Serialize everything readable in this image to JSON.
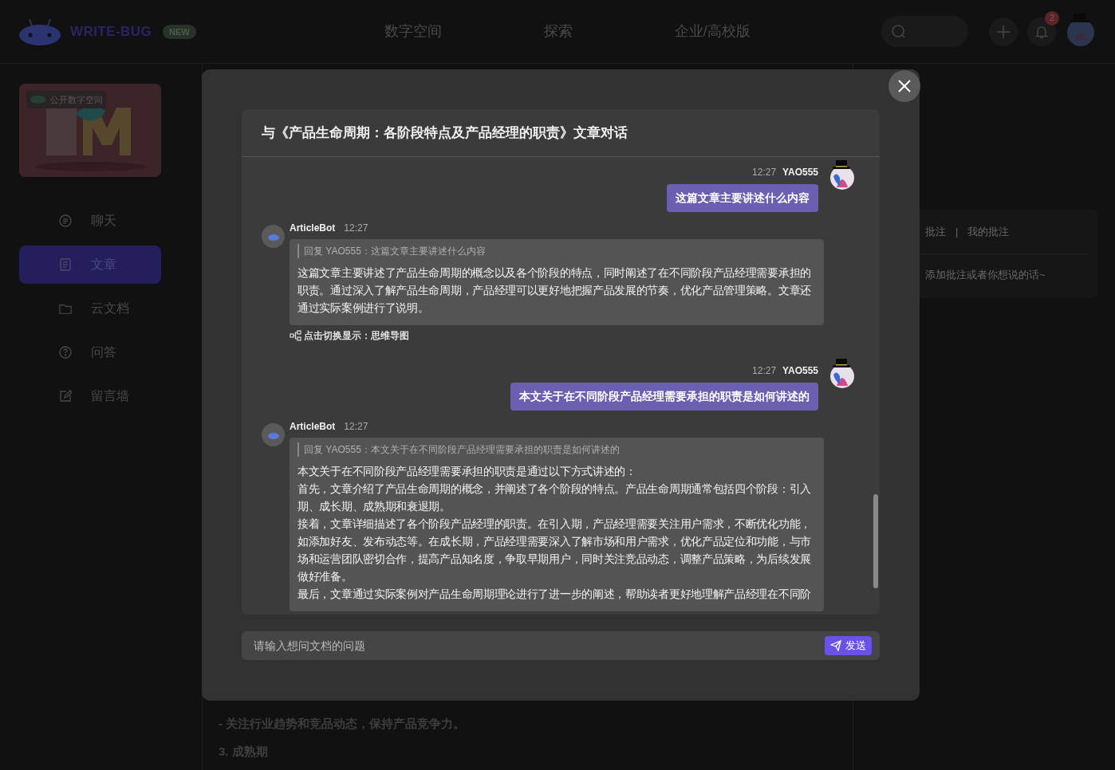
{
  "header": {
    "logo_text": "WRITE-BUG",
    "badge": "NEW",
    "nav": [
      {
        "label": "数字空间",
        "selected": false
      },
      {
        "label": "探索",
        "selected": false
      },
      {
        "label": "企业/高校版",
        "selected": false
      }
    ],
    "notification_count": "2"
  },
  "sidebar": {
    "card_label": "公开数字空间",
    "items": [
      {
        "label": "聊天",
        "selected": false
      },
      {
        "label": "文章",
        "selected": true
      },
      {
        "label": "云文档",
        "selected": false
      },
      {
        "label": "问答",
        "selected": false
      },
      {
        "label": "留言墙",
        "selected": false
      }
    ]
  },
  "article": {
    "lines": [
      "- 关注行业趋势和竞品动态，保持产品竞争力。",
      "3. 成熟期"
    ]
  },
  "annotations": {
    "separator": "|",
    "tabs": [
      {
        "label": "批注",
        "selected": false
      },
      {
        "label": "我的批注",
        "selected": false
      }
    ],
    "hint": "添加批注或者你想说的话~"
  },
  "dialog": {
    "title": "与《产品生命周期：各阶段特点及产品经理的职责》文章对话",
    "messages": [
      {
        "kind": "user",
        "time": "12:27",
        "author": "YAO555",
        "text": "这篇文章主要讲述什么内容"
      },
      {
        "kind": "bot",
        "author": "ArticleBot",
        "time": "12:27",
        "quote": "回复 YAO555：这篇文章主要讲述什么内容",
        "paragraphs": [
          "这篇文章主要讲述了产品生命周期的概念以及各个阶段的特点，同时阐述了在不同阶段产品经理需要承担的职责。通过深入了解产品生命周期，产品经理可以更好地把握产品发展的节奏，优化产品管理策略。文章还通过实际案例进行了说明。"
        ],
        "toggle_link": "点击切换显示：思维导图"
      },
      {
        "kind": "user",
        "time": "12:27",
        "author": "YAO555",
        "text": "本文关于在不同阶段产品经理需要承担的职责是如何讲述的"
      },
      {
        "kind": "bot",
        "author": "ArticleBot",
        "time": "12:27",
        "quote": "回复 YAO555：本文关于在不同阶段产品经理需要承担的职责是如何讲述的",
        "paragraphs": [
          "本文关于在不同阶段产品经理需要承担的职责是通过以下方式讲述的：",
          "首先，文章介绍了产品生命周期的概念，并阐述了各个阶段的特点。产品生命周期通常包括四个阶段：引入期、成长期、成熟期和衰退期。",
          "接着，文章详细描述了各个阶段产品经理的职责。在引入期，产品经理需要关注用户需求，不断优化功能，如添加好友、发布动态等。在成长期，产品经理需要深入了解市场和用户需求，优化产品定位和功能，与市场和运营团队密切合作，提高产品知名度，争取早期用户，同时关注竞品动态，调整产品策略，为后续发展做好准备。",
          "最后，文章通过实际案例对产品生命周期理论进行了进一步的阐述，帮助读者更好地理解产品经理在不同阶"
        ]
      }
    ],
    "input": {
      "placeholder": "请输入想问文档的问题"
    },
    "send_label": "发送"
  }
}
